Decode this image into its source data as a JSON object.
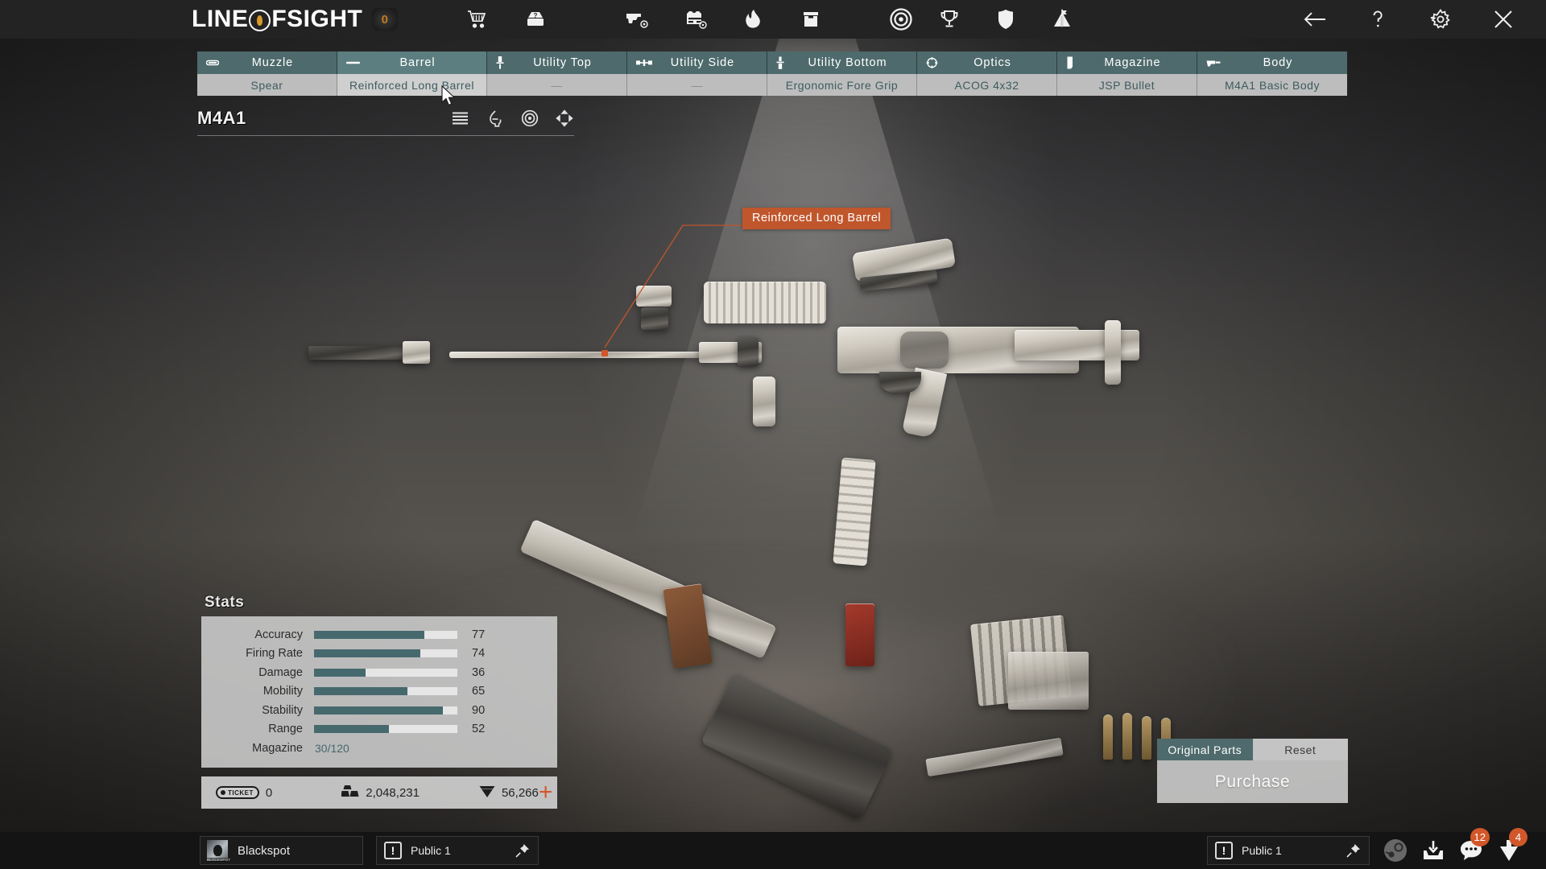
{
  "app": {
    "title": "LINE OF SIGHT",
    "logo_text_a": "LINE",
    "logo_text_of_o": "O",
    "logo_text_of_f": "F",
    "logo_text_b": "SIGHT",
    "logo_badge": "0"
  },
  "topbar": {
    "icons": [
      {
        "name": "cart-icon",
        "label": "Shop"
      },
      {
        "name": "mystery-box-icon",
        "label": "Mystery Box"
      },
      {
        "name": "weapon-customize-icon",
        "label": "Weapon Customization"
      },
      {
        "name": "gear-customize-icon",
        "label": "Gear Customization"
      },
      {
        "name": "flame-icon",
        "label": "Boosts"
      },
      {
        "name": "inventory-box-icon",
        "label": "Inventory"
      },
      {
        "name": "target-icon",
        "label": "Missions"
      },
      {
        "name": "trophy-icon",
        "label": "Achievements"
      },
      {
        "name": "shield-icon",
        "label": "Clan"
      },
      {
        "name": "camp-icon",
        "label": "Camp"
      }
    ],
    "window_controls": [
      {
        "name": "back-arrow-icon",
        "label": "Back"
      },
      {
        "name": "help-icon",
        "label": "Help"
      },
      {
        "name": "settings-gear-icon",
        "label": "Settings"
      },
      {
        "name": "close-icon",
        "label": "Close"
      }
    ]
  },
  "slots": [
    {
      "icon": "muzzle-icon",
      "title": "Muzzle",
      "value": "Spear",
      "active": false
    },
    {
      "icon": "barrel-icon",
      "title": "Barrel",
      "value": "Reinforced Long Barrel",
      "active": true
    },
    {
      "icon": "utility-top-icon",
      "title": "Utility Top",
      "value": "—",
      "active": false
    },
    {
      "icon": "utility-side-icon",
      "title": "Utility Side",
      "value": "—",
      "active": false
    },
    {
      "icon": "utility-bottom-icon",
      "title": "Utility Bottom",
      "value": "Ergonomic Fore Grip",
      "active": false
    },
    {
      "icon": "optics-icon",
      "title": "Optics",
      "value": "ACOG 4x32",
      "active": false
    },
    {
      "icon": "magazine-icon",
      "title": "Magazine",
      "value": "JSP Bullet",
      "active": false
    },
    {
      "icon": "body-icon",
      "title": "Body",
      "value": "M4A1 Basic Body",
      "active": false
    }
  ],
  "weapon": {
    "name": "M4A1",
    "tools": [
      {
        "name": "list-view-icon",
        "label": "List View"
      },
      {
        "name": "paint-icon",
        "label": "Paint"
      },
      {
        "name": "sight-icon",
        "label": "Sight Preview"
      },
      {
        "name": "move-icon",
        "label": "Rotate / Move"
      }
    ]
  },
  "callout": {
    "label": "Reinforced Long Barrel",
    "color": "#c0562c"
  },
  "stats": {
    "title": "Stats",
    "accent": "#46696e",
    "rows": [
      {
        "label": "Accuracy",
        "value": 77
      },
      {
        "label": "Firing Rate",
        "value": 74
      },
      {
        "label": "Damage",
        "value": 36
      },
      {
        "label": "Mobility",
        "value": 65
      },
      {
        "label": "Stability",
        "value": 90
      },
      {
        "label": "Range",
        "value": 52
      }
    ],
    "magazine_label": "Magazine",
    "magazine_value": "30/120"
  },
  "currency": {
    "ticket_badge": "TICKET",
    "ticket_value": "0",
    "gold_value": "2,048,231",
    "gem_value": "56,266",
    "plus_label": "+",
    "plus_color": "#d2572a"
  },
  "purchase": {
    "tab_original": "Original Parts",
    "tab_reset": "Reset",
    "button": "Purchase"
  },
  "taskbar": {
    "blackspot_label": "Blackspot",
    "blackspot_icon_caption": "BLACKSPOT",
    "channel_left": "Public 1",
    "channel_right": "Public 1",
    "alert_glyph": "!",
    "tray": [
      {
        "name": "steam-icon",
        "badge": null
      },
      {
        "name": "download-icon",
        "badge": null
      },
      {
        "name": "chat-icon",
        "badge": "12"
      },
      {
        "name": "friends-icon",
        "badge": "4"
      }
    ]
  }
}
